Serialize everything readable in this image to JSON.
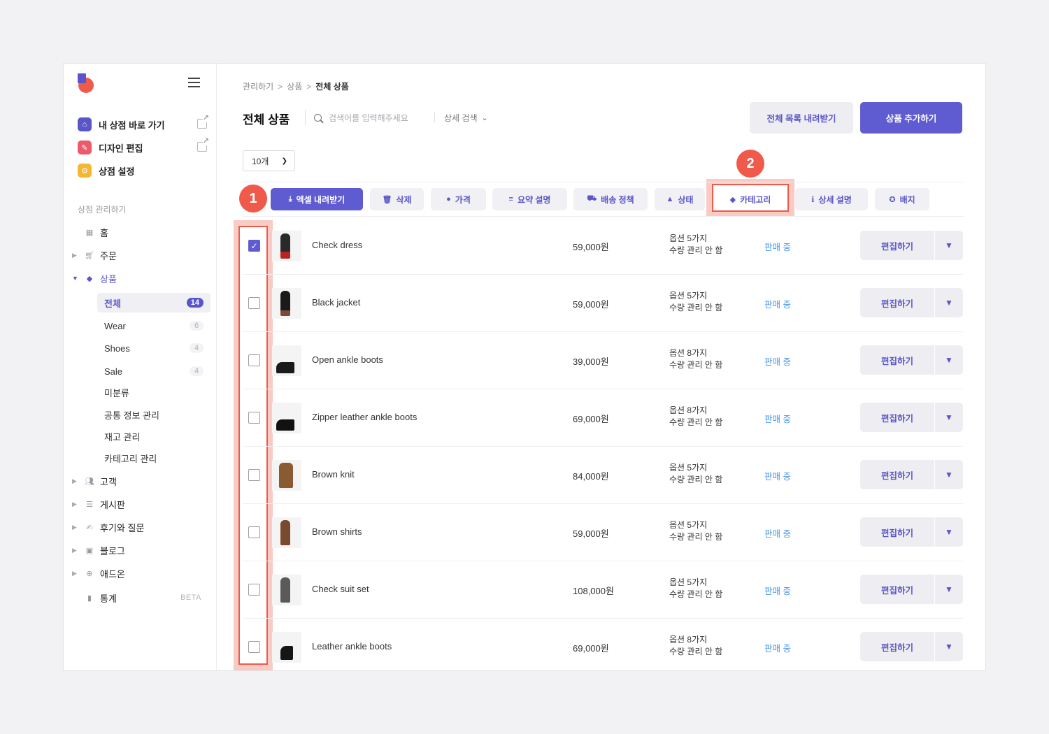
{
  "breadcrumb": [
    "관리하기",
    "상품",
    "전체 상품"
  ],
  "breadcrumb_sep": ">",
  "page_title": "전체 상품",
  "search": {
    "placeholder": "검색어를 입력해주세요",
    "detail_label": "상세 검색"
  },
  "header_buttons": {
    "download_all": "전체 목록 내려받기",
    "add_product": "상품 추가하기"
  },
  "per_page": "10개",
  "quick_links": [
    {
      "label": "내 상점 바로 가기",
      "icon": "home-icon",
      "color": "#5a55c8"
    },
    {
      "label": "디자인 편집",
      "icon": "pencil-icon",
      "color": "#ef5a6a"
    },
    {
      "label": "상점 설정",
      "icon": "gear-icon",
      "color": "#f5b631"
    }
  ],
  "sidebar_section": "상점 관리하기",
  "nav": {
    "home": "홈",
    "orders": "주문",
    "products": "상품",
    "customers": "고객",
    "board": "게시판",
    "reviews": "후기와 질문",
    "blog": "블로그",
    "addon": "애드온",
    "stats": "통계",
    "stats_badge": "BETA"
  },
  "product_sub": [
    {
      "label": "전체",
      "count": "14"
    },
    {
      "label": "Wear",
      "count": "6"
    },
    {
      "label": "Shoes",
      "count": "4"
    },
    {
      "label": "Sale",
      "count": "4"
    },
    {
      "label": "미분류",
      "count": ""
    },
    {
      "label": "공통 정보 관리",
      "count": ""
    },
    {
      "label": "재고 관리",
      "count": ""
    },
    {
      "label": "카테고리 관리",
      "count": ""
    }
  ],
  "toolbar": {
    "excel": "엑셀 내려받기",
    "delete": "삭제",
    "price": "가격",
    "summary": "요약 설명",
    "shipping": "배송 정책",
    "state": "상태",
    "category": "카테고리",
    "detail": "상세 설명",
    "badge": "배지"
  },
  "markers": {
    "one": "1",
    "two": "2"
  },
  "products": [
    {
      "name": "Check dress",
      "price": "59,000원",
      "options": "옵션 5가지",
      "stock": "수량 관리 안 함",
      "status": "판매 중",
      "checked": true
    },
    {
      "name": "Black jacket",
      "price": "59,000원",
      "options": "옵션 5가지",
      "stock": "수량 관리 안 함",
      "status": "판매 중",
      "checked": false
    },
    {
      "name": "Open ankle boots",
      "price": "39,000원",
      "options": "옵션 8가지",
      "stock": "수량 관리 안 함",
      "status": "판매 중",
      "checked": false
    },
    {
      "name": "Zipper leather ankle boots",
      "price": "69,000원",
      "options": "옵션 8가지",
      "stock": "수량 관리 안 함",
      "status": "판매 중",
      "checked": false
    },
    {
      "name": "Brown knit",
      "price": "84,000원",
      "options": "옵션 5가지",
      "stock": "수량 관리 안 함",
      "status": "판매 중",
      "checked": false
    },
    {
      "name": "Brown shirts",
      "price": "59,000원",
      "options": "옵션 5가지",
      "stock": "수량 관리 안 함",
      "status": "판매 중",
      "checked": false
    },
    {
      "name": "Check suit set",
      "price": "108,000원",
      "options": "옵션 5가지",
      "stock": "수량 관리 안 함",
      "status": "판매 중",
      "checked": false
    },
    {
      "name": "Leather ankle boots",
      "price": "69,000원",
      "options": "옵션 8가지",
      "stock": "수량 관리 안 함",
      "status": "판매 중",
      "checked": false
    }
  ],
  "row_action": {
    "edit": "편집하기",
    "more": "▼"
  },
  "colors": {
    "accent": "#5f5bd0",
    "highlight": "#ef5a4a",
    "status": "#4a98e8"
  }
}
